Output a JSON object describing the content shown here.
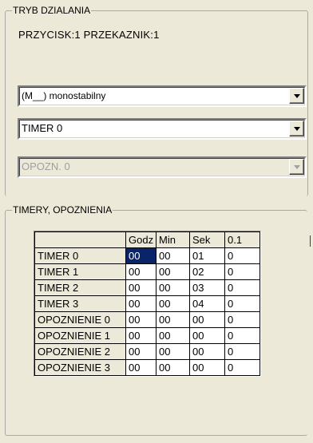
{
  "mode_group": {
    "legend": "TRYB DZIALANIA",
    "status": "PRZYCISK:1  PRZEKAZNIK:1",
    "mode_combo": {
      "value": "(M__) monostabilny",
      "disabled": false
    },
    "timer_combo": {
      "value": "TIMER 0",
      "disabled": false
    },
    "delay_combo": {
      "value": "OPOZN. 0",
      "disabled": true
    }
  },
  "timers_group": {
    "legend": "TIMERY, OPOZNIENIA",
    "table": {
      "headers": [
        "",
        "Godz",
        "Min",
        "Sek",
        "0.1"
      ],
      "rows": [
        {
          "name": "TIMER 0",
          "values": [
            "00",
            "00",
            "01",
            "0"
          ]
        },
        {
          "name": "TIMER 1",
          "values": [
            "00",
            "00",
            "02",
            "0"
          ]
        },
        {
          "name": "TIMER 2",
          "values": [
            "00",
            "00",
            "03",
            "0"
          ]
        },
        {
          "name": "TIMER 3",
          "values": [
            "00",
            "00",
            "04",
            "0"
          ]
        },
        {
          "name": "OPOZNIENIE 0",
          "values": [
            "00",
            "00",
            "00",
            "0"
          ]
        },
        {
          "name": "OPOZNIENIE 1",
          "values": [
            "00",
            "00",
            "00",
            "0"
          ]
        },
        {
          "name": "OPOZNIENIE 2",
          "values": [
            "00",
            "00",
            "00",
            "0"
          ]
        },
        {
          "name": "OPOZNIENIE 3",
          "values": [
            "00",
            "00",
            "00",
            "0"
          ]
        }
      ],
      "selected_cell": {
        "row": 0,
        "col": 1
      }
    }
  },
  "colors": {
    "window_bg": "#ece9d8",
    "selection": "#0a246a",
    "disabled_text": "#a0a0a0"
  }
}
